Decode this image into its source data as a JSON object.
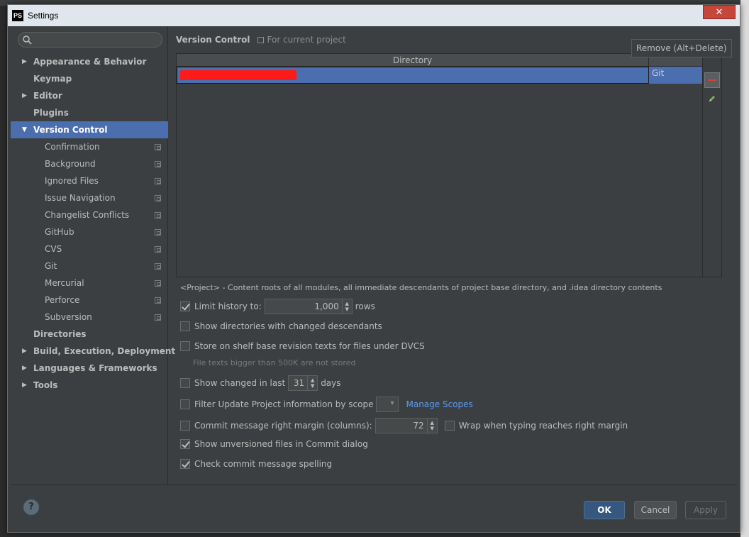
{
  "window": {
    "app_icon_text": "PS",
    "title": "Settings",
    "close_label": "✕"
  },
  "sidebar": {
    "search_placeholder": "",
    "items": [
      {
        "label": "Appearance & Behavior",
        "level": 0,
        "arrow": "▶"
      },
      {
        "label": "Keymap",
        "level": 0,
        "arrow": ""
      },
      {
        "label": "Editor",
        "level": 0,
        "arrow": "▶"
      },
      {
        "label": "Plugins",
        "level": 0,
        "arrow": ""
      },
      {
        "label": "Version Control",
        "level": 0,
        "arrow": "▼",
        "selected": true
      },
      {
        "label": "Confirmation",
        "level": 1
      },
      {
        "label": "Background",
        "level": 1
      },
      {
        "label": "Ignored Files",
        "level": 1
      },
      {
        "label": "Issue Navigation",
        "level": 1
      },
      {
        "label": "Changelist Conflicts",
        "level": 1
      },
      {
        "label": "GitHub",
        "level": 1
      },
      {
        "label": "CVS",
        "level": 1
      },
      {
        "label": "Git",
        "level": 1
      },
      {
        "label": "Mercurial",
        "level": 1
      },
      {
        "label": "Perforce",
        "level": 1
      },
      {
        "label": "Subversion",
        "level": 1
      },
      {
        "label": "Directories",
        "level": 0,
        "arrow": ""
      },
      {
        "label": "Build, Execution, Deployment",
        "level": 0,
        "arrow": "▶"
      },
      {
        "label": "Languages & Frameworks",
        "level": 0,
        "arrow": "▶"
      },
      {
        "label": "Tools",
        "level": 0,
        "arrow": "▶"
      }
    ]
  },
  "main": {
    "title": "Version Control",
    "scope": "For current project",
    "table": {
      "col_directory": "Directory",
      "rows": [
        {
          "directory": "",
          "vcs": "Git"
        }
      ]
    },
    "tooltip": "Remove (Alt+Delete)",
    "note": "<Project> - Content roots of all modules, all immediate descendants of project base directory, and .idea directory contents",
    "options": {
      "limit_history": {
        "label": "Limit history to:",
        "value": "1,000",
        "suffix": "rows",
        "checked": true
      },
      "show_dirs_changed": {
        "label": "Show directories with changed descendants",
        "checked": false
      },
      "store_shelf": {
        "label": "Store on shelf base revision texts for files under DVCS",
        "checked": false
      },
      "store_shelf_hint": "File texts bigger than 500K are not stored",
      "show_changed_last": {
        "label": "Show changed in last",
        "value": "31",
        "suffix": "days",
        "checked": false
      },
      "filter_update": {
        "label": "Filter Update Project information by scope",
        "link": "Manage Scopes",
        "checked": false
      },
      "commit_margin": {
        "label": "Commit message right margin (columns):",
        "value": "72",
        "checked": false
      },
      "wrap_typing": {
        "label": "Wrap when typing reaches right margin",
        "checked": false
      },
      "show_unversioned": {
        "label": "Show unversioned files in Commit dialog",
        "checked": true
      },
      "check_spelling": {
        "label": "Check commit message spelling",
        "checked": true
      }
    }
  },
  "footer": {
    "help": "?",
    "ok": "OK",
    "cancel": "Cancel",
    "apply": "Apply"
  },
  "colors": {
    "selection": "#4b6eaf",
    "link": "#589df6",
    "redaction": "#ff1a1a"
  }
}
